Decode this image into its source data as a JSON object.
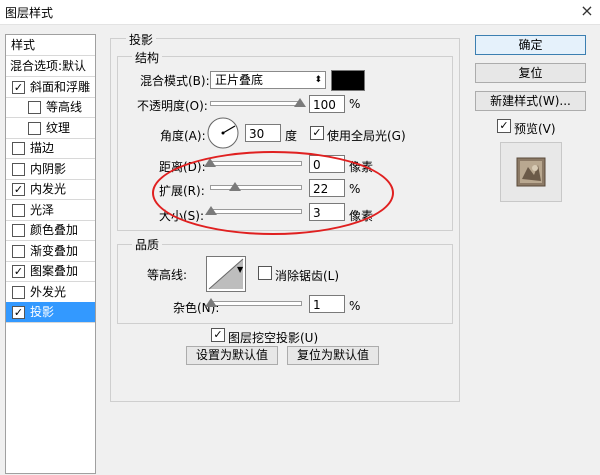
{
  "window": {
    "title": "图层样式",
    "close_icon": "×"
  },
  "left_panel": {
    "header": "样式",
    "items": [
      {
        "label": "混合选项:默认",
        "checkbox": false,
        "checked": false,
        "indent": false
      },
      {
        "label": "斜面和浮雕",
        "checkbox": true,
        "checked": true,
        "indent": false
      },
      {
        "label": "等高线",
        "checkbox": true,
        "checked": false,
        "indent": true
      },
      {
        "label": "纹理",
        "checkbox": true,
        "checked": false,
        "indent": true
      },
      {
        "label": "描边",
        "checkbox": true,
        "checked": false,
        "indent": false
      },
      {
        "label": "内阴影",
        "checkbox": true,
        "checked": false,
        "indent": false
      },
      {
        "label": "内发光",
        "checkbox": true,
        "checked": true,
        "indent": false
      },
      {
        "label": "光泽",
        "checkbox": true,
        "checked": false,
        "indent": false
      },
      {
        "label": "颜色叠加",
        "checkbox": true,
        "checked": false,
        "indent": false
      },
      {
        "label": "渐变叠加",
        "checkbox": true,
        "checked": false,
        "indent": false
      },
      {
        "label": "图案叠加",
        "checkbox": true,
        "checked": true,
        "indent": false
      },
      {
        "label": "外发光",
        "checkbox": true,
        "checked": false,
        "indent": false
      },
      {
        "label": "投影",
        "checkbox": true,
        "checked": true,
        "indent": false,
        "selected": true
      }
    ]
  },
  "drop_shadow": {
    "group_title": "投影",
    "structure": {
      "title": "结构",
      "blend_mode_label": "混合模式(B):",
      "blend_mode_value": "正片叠底",
      "blend_color": "#000000",
      "opacity_label": "不透明度(O):",
      "opacity_value": "100",
      "opacity_unit": "%",
      "opacity_level": 1.0,
      "angle_label": "角度(A):",
      "angle_value": "30",
      "angle_unit": "度",
      "global_light_label": "使用全局光(G)",
      "global_light_checked": true,
      "distance_label": "距离(D):",
      "distance_value": "0",
      "distance_unit": "像素",
      "distance_level": 0.0,
      "spread_label": "扩展(R):",
      "spread_value": "22",
      "spread_unit": "%",
      "spread_level": 0.22,
      "size_label": "大小(S):",
      "size_value": "3",
      "size_unit": "像素",
      "size_level": 0.01
    },
    "quality": {
      "title": "品质",
      "contour_label": "等高线:",
      "anti_alias_label": "消除锯齿(L)",
      "anti_alias_checked": false,
      "noise_label": "杂色(N):",
      "noise_value": "1",
      "noise_unit": "%",
      "noise_level": 0.01
    },
    "knockout_label": "图层挖空投影(U)",
    "knockout_checked": true,
    "make_default_label": "设置为默认值",
    "reset_default_label": "复位为默认值"
  },
  "buttons": {
    "ok": "确定",
    "reset": "复位",
    "new_style": "新建样式(W)...",
    "preview_label": "预览(V)",
    "preview_checked": true
  },
  "check_glyph": "✓"
}
